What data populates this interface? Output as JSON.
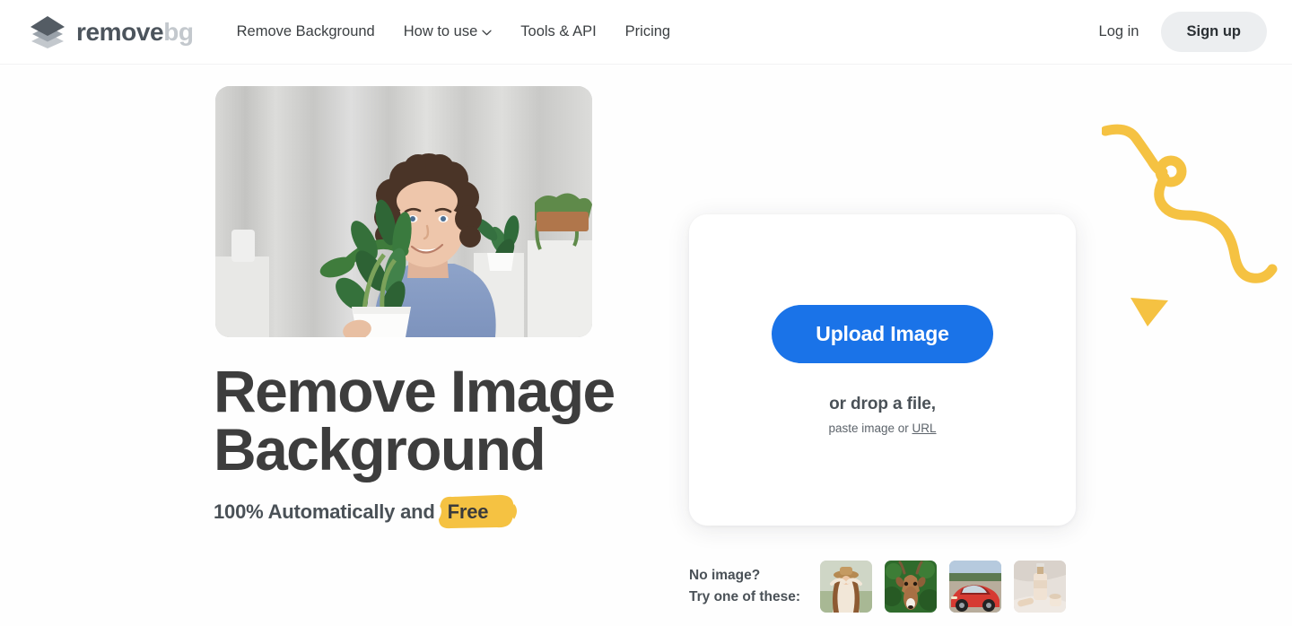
{
  "header": {
    "logo": {
      "icon": "layers-diamond-icon",
      "text_primary": "remove",
      "text_secondary": "bg"
    },
    "nav": [
      {
        "label": "Remove Background",
        "has_chevron": false
      },
      {
        "label": "How to use",
        "has_chevron": true,
        "chevron_icon": "chevron-down-icon"
      },
      {
        "label": "Tools & API",
        "has_chevron": false
      },
      {
        "label": "Pricing",
        "has_chevron": false
      }
    ],
    "login_label": "Log in",
    "signup_label": "Sign up"
  },
  "hero": {
    "photo_alt": "man with curly hair in blue t-shirt holding a potted plant",
    "title_line1": "Remove Image",
    "title_line2": "Background",
    "subtitle_prefix": "100% Automatically and",
    "subtitle_highlight": "Free"
  },
  "upload": {
    "button_label": "Upload Image",
    "drop_text": "or drop a file,",
    "paste_prefix": "paste image or ",
    "paste_link": "URL"
  },
  "samples": {
    "label_line1": "No image?",
    "label_line2": "Try one of these:",
    "thumbnails": [
      {
        "name": "sample-woman-hat"
      },
      {
        "name": "sample-antelope"
      },
      {
        "name": "sample-red-car"
      },
      {
        "name": "sample-cosmetics"
      }
    ]
  },
  "decor": {
    "squiggle": "yellow-squiggle-line",
    "triangle": "yellow-triangle"
  },
  "colors": {
    "accent_blue": "#1a73e8",
    "accent_yellow": "#f5c242",
    "text_dark": "#3d3d3d",
    "text_muted": "#4a5157",
    "logo_gray": "#4c545c",
    "logo_light": "#c3c8cd",
    "page_bg": "#fefefe",
    "signup_bg": "#eceef0"
  }
}
